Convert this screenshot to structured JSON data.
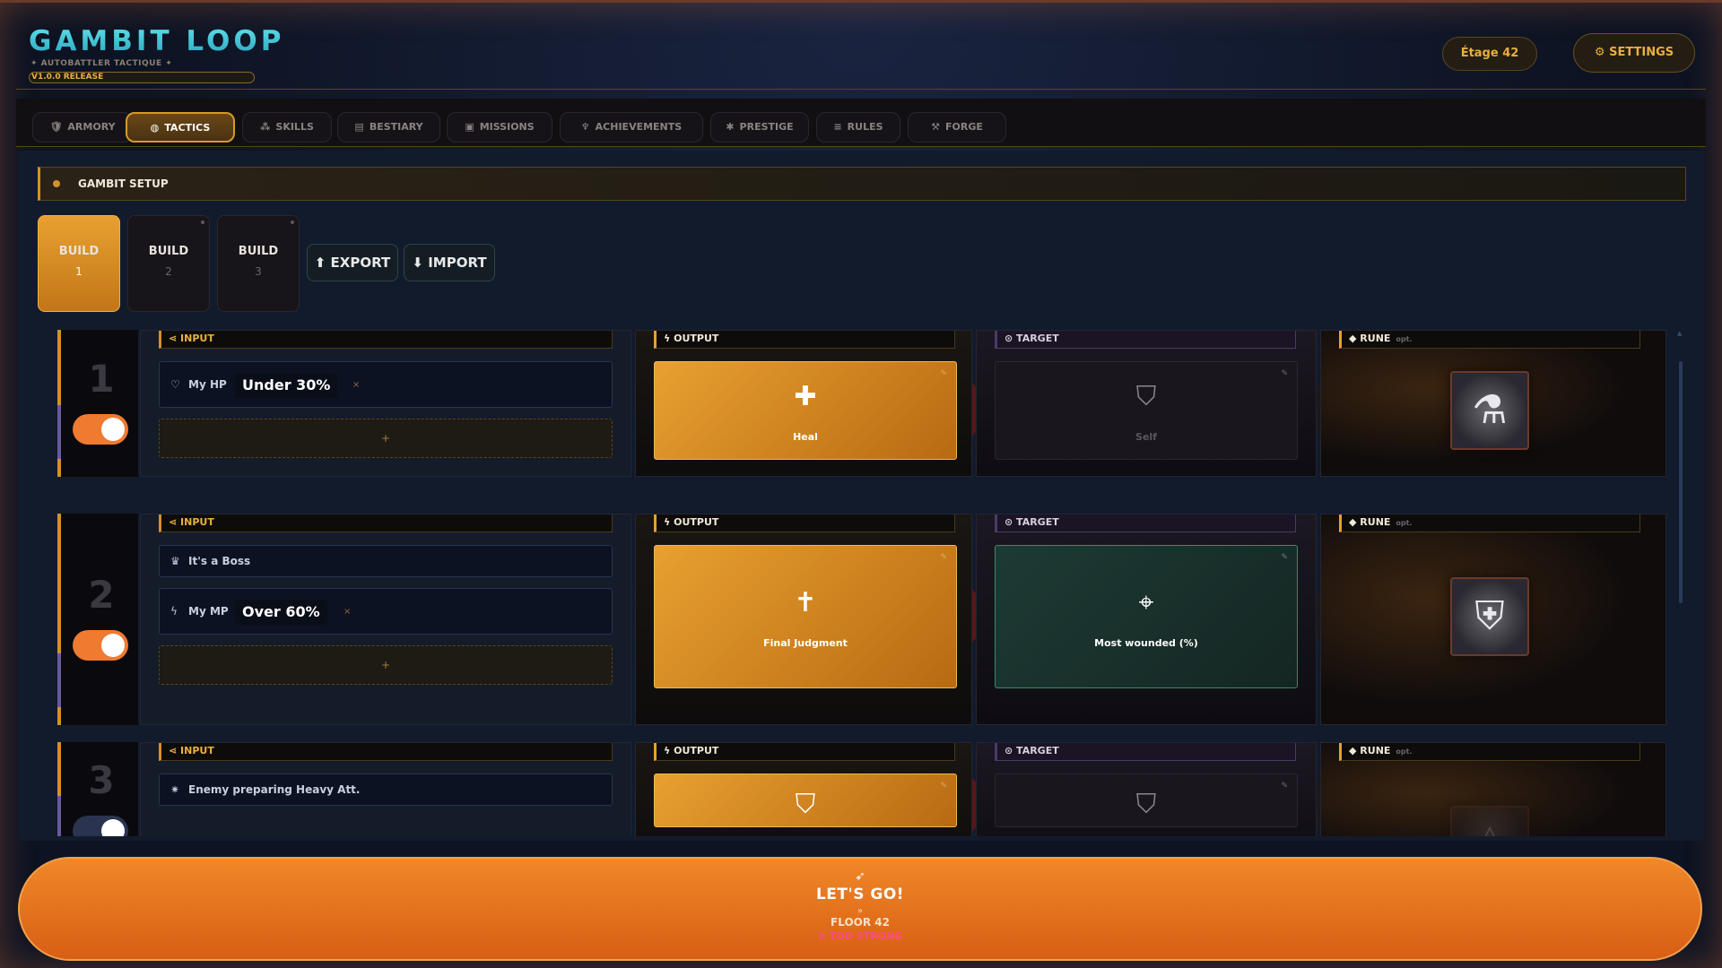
{
  "header": {
    "logo": "GAMBIT LOOP",
    "subtitle": "✦ AUTOBATTLER TACTIQUE ✦",
    "version": "V1.0.0 RELEASE",
    "etage": "Étage 42",
    "settings": "SETTINGS",
    "settings_icon": "gear-icon"
  },
  "tabs": [
    {
      "label": "ARMORY",
      "icon": "shield-icon",
      "glyph": "🛡",
      "active": false
    },
    {
      "label": "TACTICS",
      "icon": "brain-icon",
      "glyph": "◍",
      "active": true
    },
    {
      "label": "SKILLS",
      "icon": "tree-icon",
      "glyph": "⁂",
      "active": false
    },
    {
      "label": "BESTIARY",
      "icon": "book-icon",
      "glyph": "▤",
      "active": false
    },
    {
      "label": "MISSIONS",
      "icon": "clipboard-icon",
      "glyph": "▣",
      "active": false
    },
    {
      "label": "ACHIEVEMENTS",
      "icon": "trophy-icon",
      "glyph": "♆",
      "active": false
    },
    {
      "label": "PRESTIGE",
      "icon": "star-icon",
      "glyph": "✱",
      "active": false
    },
    {
      "label": "RULES",
      "icon": "list-icon",
      "glyph": "≡",
      "active": false
    },
    {
      "label": "FORGE",
      "icon": "hammer-icon",
      "glyph": "⚒",
      "active": false
    }
  ],
  "setup": {
    "title": "GAMBIT SETUP",
    "builds": [
      {
        "label": "BUILD",
        "number": "1",
        "active": true
      },
      {
        "label": "BUILD",
        "number": "2",
        "active": false
      },
      {
        "label": "BUILD",
        "number": "3",
        "active": false
      }
    ],
    "export_label": "⬆ EXPORT",
    "import_label": "⬇ IMPORT"
  },
  "columns": {
    "input": "INPUT",
    "output": "OUTPUT",
    "target": "TARGET",
    "rune": "RUNE",
    "rune_opt": "opt."
  },
  "gambits": [
    {
      "number": "1",
      "enabled": true,
      "conditions": [
        {
          "icon": "heart-icon",
          "glyph": "♡",
          "label": "My HP",
          "value": "Under 30%",
          "remove": "×"
        }
      ],
      "add": "+",
      "output": {
        "label": "Heal",
        "icon": "medkit-icon",
        "glyph": "✚",
        "style": "gold"
      },
      "target": {
        "label": "Self",
        "icon": "shield-icon",
        "glyph": "⛉",
        "style": "dim"
      },
      "rune": {
        "icon": "potion-icon",
        "glyph": "⚗"
      }
    },
    {
      "number": "2",
      "enabled": true,
      "conditions": [
        {
          "icon": "crown-icon",
          "glyph": "♛",
          "label": "It's a Boss",
          "value": "",
          "remove": ""
        },
        {
          "icon": "lightning-icon",
          "glyph": "ϟ",
          "label": "My MP",
          "value": "Over 60%",
          "remove": "×"
        }
      ],
      "add": "+",
      "output": {
        "label": "Final Judgment",
        "icon": "cross-icon",
        "glyph": "✝",
        "style": "gold"
      },
      "target": {
        "label": "Most wounded (%)",
        "icon": "crosshair-icon",
        "glyph": "⌖",
        "style": "teal"
      },
      "rune": {
        "icon": "holy-shield-icon",
        "glyph": "⛨"
      }
    },
    {
      "number": "3",
      "enabled": false,
      "conditions": [
        {
          "icon": "burst-icon",
          "glyph": "✷",
          "label": "Enemy preparing Heavy Att.",
          "value": "",
          "remove": ""
        }
      ],
      "add": "",
      "output": {
        "label": "",
        "icon": "shield-icon",
        "glyph": "⛉",
        "style": "gold"
      },
      "target": {
        "label": "",
        "icon": "shield-icon",
        "glyph": "⛉",
        "style": "dim"
      },
      "rune": {
        "icon": "rune-icon",
        "glyph": "◬"
      }
    }
  ],
  "go": {
    "icon": "send-icon",
    "glyph": "➶",
    "label": "LET'S GO!",
    "chevron": "»",
    "floor": "FLOOR 42",
    "warning": "⊘ TOO STRONG"
  }
}
